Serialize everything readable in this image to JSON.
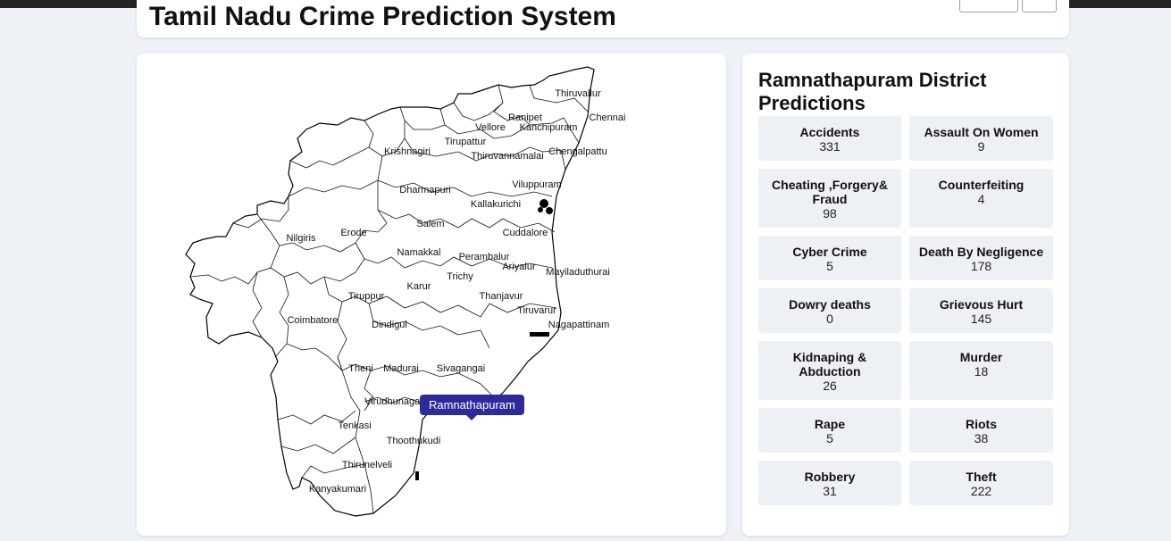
{
  "header": {
    "title": "Tamil Nadu Crime Prediction System"
  },
  "map": {
    "districts": [
      "Thiruvallur",
      "Chennai",
      "Ranipet",
      "Vellore",
      "Kanchipuram",
      "Tirupattur",
      "Krishnagiri",
      "Chengalpattu",
      "Thiruvannamalai",
      "Dharmapuri",
      "Viluppuram",
      "Kallakurichi",
      "Salem",
      "Nilgiris",
      "Erode",
      "Cuddalore",
      "Namakkal",
      "Perambalur",
      "Ariyalur",
      "Mayiladuthurai",
      "Trichy",
      "Karur",
      "Tiruppur",
      "Thanjavur",
      "Tiruvarur",
      "Coimbatore",
      "Dindigul",
      "Nagapattinam",
      "Theni",
      "Madurai",
      "Sivagangai",
      "Virudhunagar",
      "Ramnathapuram",
      "Tenkasi",
      "Thoothukudi",
      "Thirunelveli",
      "Kanyakumari"
    ],
    "tooltip": "Ramnathapuram"
  },
  "predictions": {
    "title": "Ramnathapuram District Predictions",
    "items": [
      {
        "name": "Accidents",
        "value": "331"
      },
      {
        "name": "Assault On Women",
        "value": "9"
      },
      {
        "name": "Cheating ,Forgery& Fraud",
        "value": "98"
      },
      {
        "name": "Counterfeiting",
        "value": "4"
      },
      {
        "name": "Cyber Crime",
        "value": "5"
      },
      {
        "name": "Death By Negligence",
        "value": "178"
      },
      {
        "name": "Dowry deaths",
        "value": "0"
      },
      {
        "name": "Grievous Hurt",
        "value": "145"
      },
      {
        "name": "Kidnaping & Abduction",
        "value": "26"
      },
      {
        "name": "Murder",
        "value": "18"
      },
      {
        "name": "Rape",
        "value": "5"
      },
      {
        "name": "Riots",
        "value": "38"
      },
      {
        "name": "Robbery",
        "value": "31"
      },
      {
        "name": "Theft",
        "value": "222"
      }
    ]
  }
}
